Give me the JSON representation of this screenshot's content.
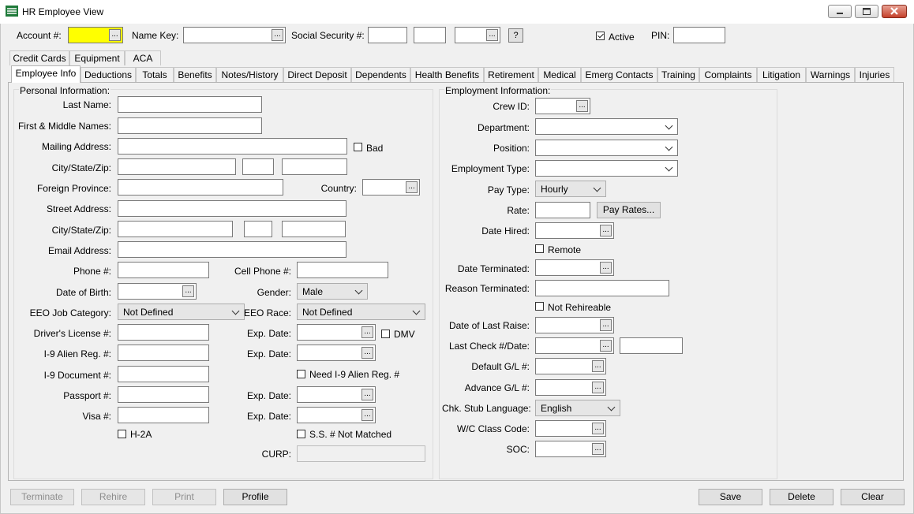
{
  "window": {
    "title": "HR Employee View"
  },
  "header": {
    "account_label": "Account #:",
    "name_key_label": "Name Key:",
    "ssn_label": "Social Security #:",
    "help_label": "?",
    "active_label": "Active",
    "pin_label": "PIN:",
    "active_checked": true
  },
  "tabs_row1": [
    "Credit Cards",
    "Equipment",
    "ACA"
  ],
  "tabs_row2": [
    "Employee Info",
    "Deductions",
    "Totals",
    "Benefits",
    "Notes/History",
    "Direct Deposit",
    "Dependents",
    "Health Benefits",
    "Retirement",
    "Medical",
    "Emerg Contacts",
    "Training",
    "Complaints",
    "Litigation",
    "Warnings",
    "Injuries"
  ],
  "personal": {
    "group_label": "Personal Information:",
    "last_name": "Last Name:",
    "first_middle": "First & Middle Names:",
    "mailing_address": "Mailing Address:",
    "bad": "Bad",
    "city_state_zip": "City/State/Zip:",
    "foreign_province": "Foreign Province:",
    "country": "Country:",
    "street_address": "Street Address:",
    "city_state_zip2": "City/State/Zip:",
    "email": "Email Address:",
    "phone": "Phone #:",
    "cell_phone": "Cell Phone #:",
    "dob": "Date of Birth:",
    "gender": "Gender:",
    "gender_value": "Male",
    "eeo_job": "EEO Job Category:",
    "eeo_job_value": "Not Defined",
    "eeo_race": "EEO Race:",
    "eeo_race_value": "Not Defined",
    "drivers_license": "Driver's License #:",
    "exp_date": "Exp. Date:",
    "dmv": "DMV",
    "i9_alien": "I-9 Alien Reg. #:",
    "i9_doc": "I-9 Document #:",
    "need_i9": "Need I-9 Alien Reg. #",
    "passport": "Passport #:",
    "visa": "Visa #:",
    "h2a": "H-2A",
    "ss_not_matched": "S.S. # Not Matched",
    "curp": "CURP:"
  },
  "employment": {
    "group_label": "Employment Information:",
    "crew_id": "Crew ID:",
    "department": "Department:",
    "position": "Position:",
    "employment_type": "Employment Type:",
    "pay_type": "Pay Type:",
    "pay_type_value": "Hourly",
    "rate": "Rate:",
    "pay_rates_btn": "Pay Rates...",
    "date_hired": "Date Hired:",
    "remote": "Remote",
    "date_terminated": "Date Terminated:",
    "reason_terminated": "Reason Terminated:",
    "not_rehireable": "Not Rehireable",
    "date_last_raise": "Date of Last Raise:",
    "last_check": "Last Check #/Date:",
    "default_gl": "Default G/L #:",
    "advance_gl": "Advance G/L #:",
    "chk_stub_lang": "Chk. Stub Language:",
    "chk_stub_lang_value": "English",
    "wc_class": "W/C Class Code:",
    "soc": "SOC:"
  },
  "footer": {
    "terminate": "Terminate",
    "rehire": "Rehire",
    "print": "Print",
    "profile": "Profile",
    "save": "Save",
    "delete": "Delete",
    "clear": "Clear"
  },
  "ellipsis": "..."
}
